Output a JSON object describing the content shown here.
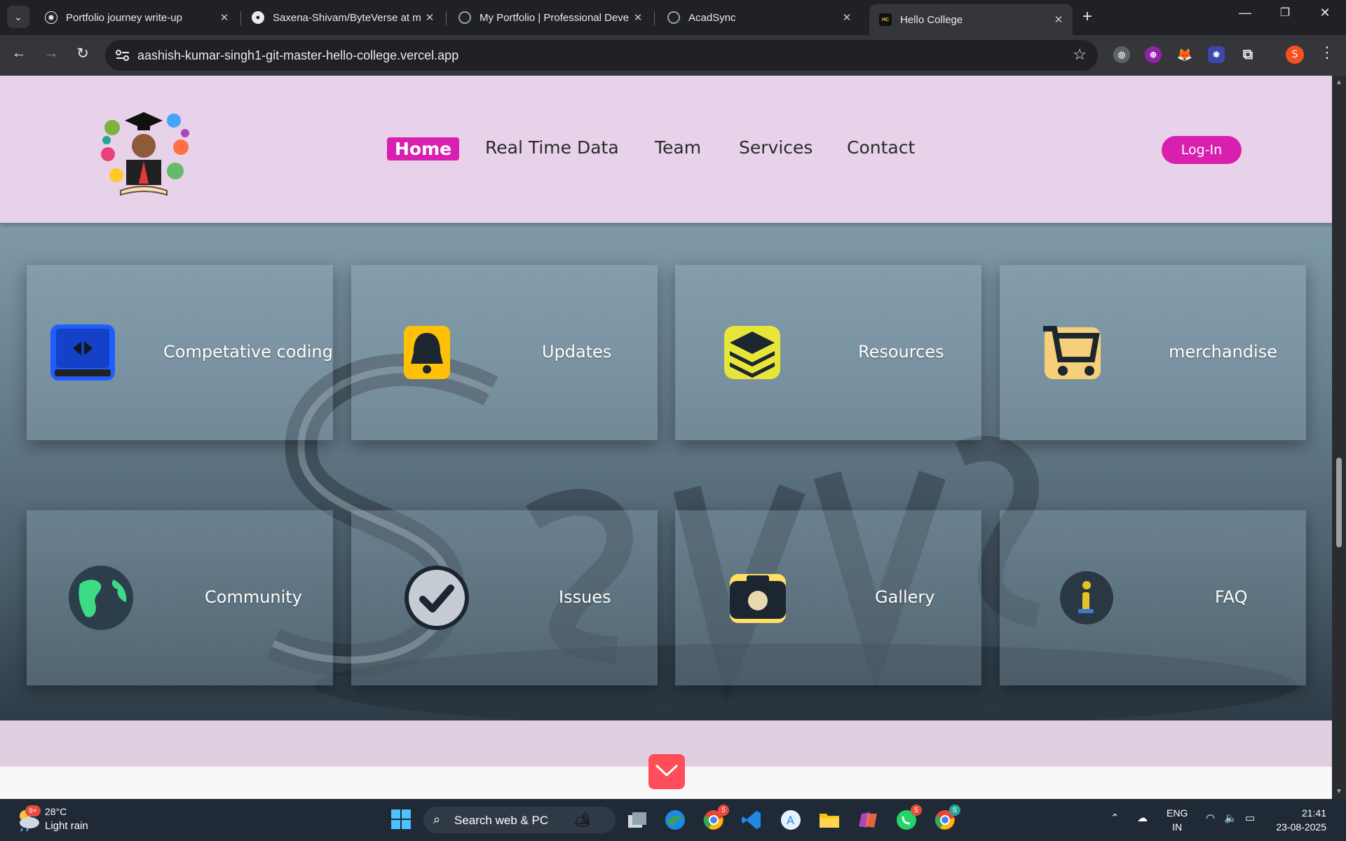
{
  "browser": {
    "tabs": [
      {
        "title": "Portfolio journey write-up",
        "favicon": "chatgpt-icon"
      },
      {
        "title": "Saxena-Shivam/ByteVerse at m",
        "favicon": "github-icon"
      },
      {
        "title": "My Portfolio | Professional Deve",
        "favicon": "globe-icon"
      },
      {
        "title": "AcadSync",
        "favicon": "globe-icon"
      },
      {
        "title": "Hello College",
        "favicon": "hc-icon",
        "active": true
      }
    ],
    "url": "aashish-kumar-singh1-git-master-hello-college.vercel.app",
    "profile_initial": "S"
  },
  "site": {
    "nav": [
      {
        "label": "Home",
        "active": true
      },
      {
        "label": "Real Time Data"
      },
      {
        "label": "Team"
      },
      {
        "label": "Services"
      },
      {
        "label": "Contact"
      }
    ],
    "login_label": "Log-In",
    "services": [
      {
        "label": "Competative coding",
        "icon": "code-monitor-icon"
      },
      {
        "label": "Updates",
        "icon": "bell-icon"
      },
      {
        "label": "Resources",
        "icon": "layers-icon"
      },
      {
        "label": "merchandise",
        "icon": "shopping-cart-icon"
      },
      {
        "label": "Community",
        "icon": "globe-earth-icon"
      },
      {
        "label": "Issues",
        "icon": "checkmark-icon"
      },
      {
        "label": "Gallery",
        "icon": "camera-icon"
      },
      {
        "label": "FAQ",
        "icon": "info-icon"
      }
    ]
  },
  "taskbar": {
    "weather_temp": "28°C",
    "weather_desc": "Light rain",
    "weather_badge": "9+",
    "search_placeholder": "Search web & PC",
    "chrome_badge": "5",
    "whatsapp_badge": "5",
    "chrome2_badge": "S",
    "lang_line1": "ENG",
    "lang_line2": "IN",
    "time": "21:41",
    "date": "23-08-2025"
  },
  "colors": {
    "header_bg": "#e8d2ea",
    "accent": "#d91fb0",
    "scroll_button": "#ff4d5a"
  }
}
